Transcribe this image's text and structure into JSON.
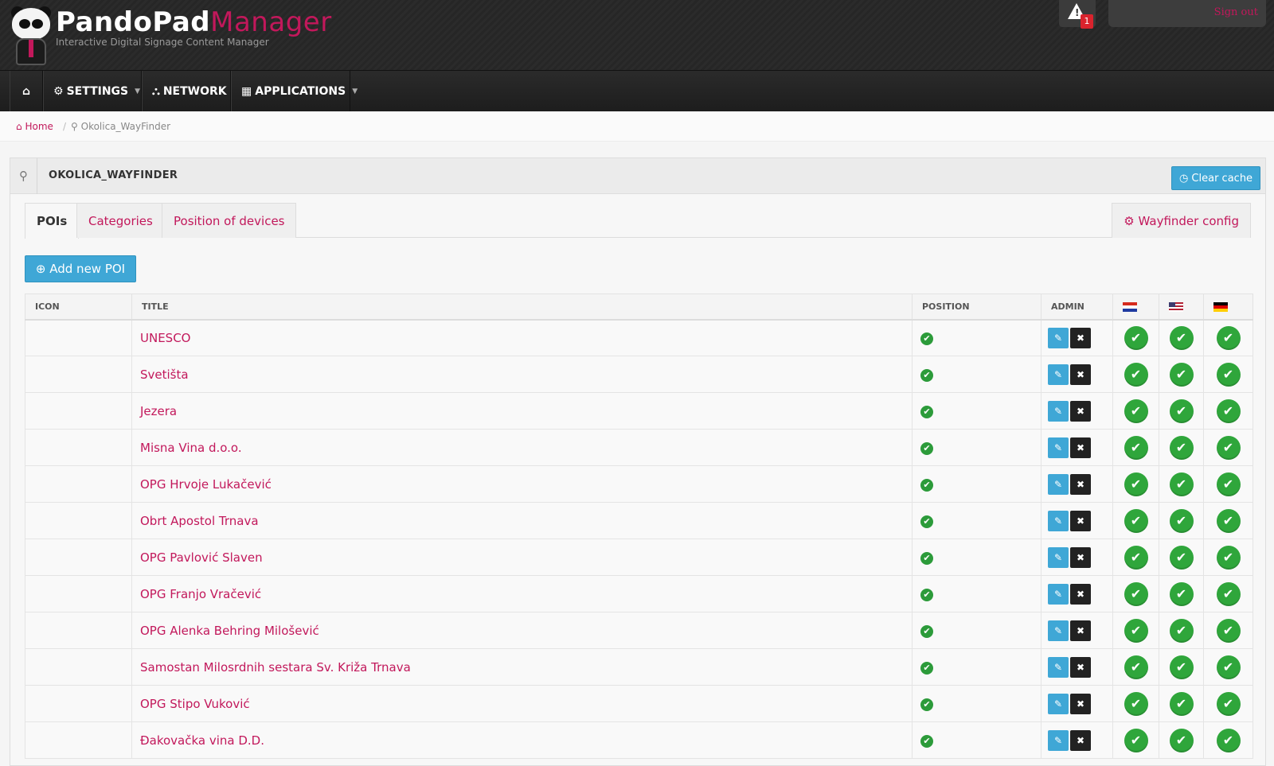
{
  "header": {
    "brand_part1": "PandoPad",
    "brand_part2": "Manager",
    "tagline": "Interactive Digital Signage Content Manager",
    "alert_count": "1",
    "sign_out": "Sign out"
  },
  "nav": {
    "home_icon": "home-icon",
    "settings": "SETTINGS",
    "network": "NETWORK",
    "applications": "APPLICATIONS"
  },
  "breadcrumb": {
    "home": "Home",
    "separator": "/",
    "current": "Okolica_WayFinder"
  },
  "panel": {
    "title": "OKOLICA_WAYFINDER",
    "clear_cache": "Clear cache"
  },
  "tabs": [
    {
      "label": "POIs",
      "active": true
    },
    {
      "label": "Categories",
      "active": false
    },
    {
      "label": "Position of devices",
      "active": false
    }
  ],
  "wayfinder_config": "Wayfinder config",
  "add_poi": "Add new POI",
  "table": {
    "headers": {
      "icon": "ICON",
      "title": "TITLE",
      "position": "POSITION",
      "admin": "ADMIN",
      "lang1": "hr-flag-icon",
      "lang2": "us-flag-icon",
      "lang3": "de-flag-icon"
    },
    "rows": [
      {
        "title": "UNESCO"
      },
      {
        "title": "Svetišta"
      },
      {
        "title": "Jezera"
      },
      {
        "title": "Misna Vina d.o.o."
      },
      {
        "title": "OPG Hrvoje Lukačević"
      },
      {
        "title": "Obrt Apostol Trnava"
      },
      {
        "title": "OPG Pavlović Slaven"
      },
      {
        "title": "OPG Franjo Vračević"
      },
      {
        "title": "OPG Alenka Behring Milošević"
      },
      {
        "title": "Samostan Milosrdnih sestara Sv. Križa Trnava"
      },
      {
        "title": "OPG Stipo Vuković"
      },
      {
        "title": "Đakovačka vina D.D."
      }
    ]
  },
  "colors": {
    "accent": "#c2185b",
    "button_blue": "#3fa7d6",
    "check_green": "#2fa63b",
    "topbar": "#262626"
  }
}
